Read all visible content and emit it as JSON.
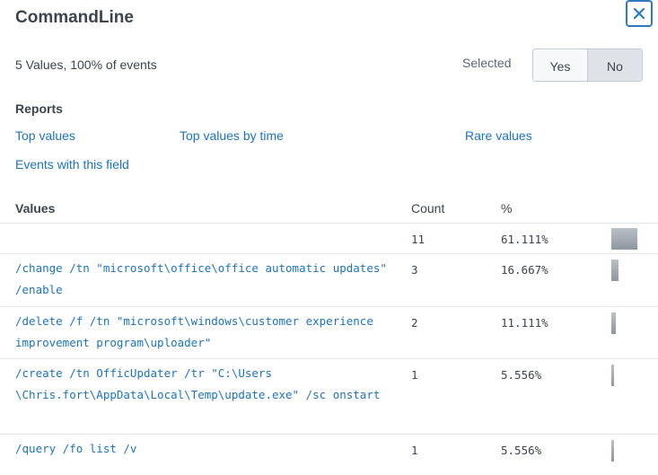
{
  "header": {
    "title": "CommandLine",
    "close_glyph": "✕"
  },
  "summary": {
    "text": "5 Values, 100% of events",
    "selected_label": "Selected",
    "yes_label": "Yes",
    "no_label": "No",
    "selected_value": "No"
  },
  "reports": {
    "heading": "Reports",
    "links": [
      "Top values",
      "Top values by time",
      "Rare values",
      "Events with this field"
    ]
  },
  "table": {
    "columns": [
      "Values",
      "Count",
      "%"
    ],
    "rows": [
      {
        "value": "",
        "count": "11",
        "percent": "61.111%",
        "fraction": 0.61111
      },
      {
        "value": "/change /tn \"microsoft\\office\\office automatic updates\" /enable",
        "count": "3",
        "percent": "16.667%",
        "fraction": 0.16667
      },
      {
        "value": "/delete /f /tn \"microsoft\\windows\\customer experience improvement program\\uploader\"",
        "count": "2",
        "percent": "11.111%",
        "fraction": 0.11111
      },
      {
        "value": "/create /tn OfficUpdater /tr \"C:\\Users \\Chris.fort\\AppData\\Local\\Temp\\update.exe\" /sc onstart",
        "count": "1",
        "percent": "5.556%",
        "fraction": 0.05556
      },
      {
        "value": "/query /fo list /v",
        "count": "1",
        "percent": "5.556%",
        "fraction": 0.05556
      }
    ]
  },
  "colors": {
    "link": "#1a73c2",
    "text": "#3c444d",
    "close_border": "#2d7bc0",
    "bar": "#9aa2ab"
  }
}
